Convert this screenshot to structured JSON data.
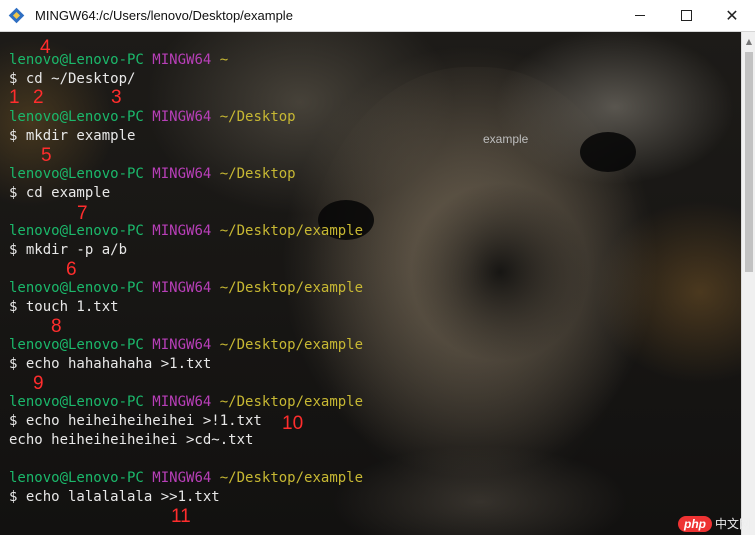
{
  "window": {
    "title": "MINGW64:/c/Users/lenovo/Desktop/example",
    "controls": {
      "minimize_icon": "minimize-icon",
      "maximize_icon": "maximize-icon",
      "close": "✕"
    }
  },
  "desktop_label": "example",
  "prompts": [
    {
      "user": "lenovo@Lenovo-PC",
      "host": "MINGW64",
      "path": "~"
    },
    {
      "user": "lenovo@Lenovo-PC",
      "host": "MINGW64",
      "path": "~/Desktop"
    },
    {
      "user": "lenovo@Lenovo-PC",
      "host": "MINGW64",
      "path": "~/Desktop"
    },
    {
      "user": "lenovo@Lenovo-PC",
      "host": "MINGW64",
      "path": "~/Desktop/example"
    },
    {
      "user": "lenovo@Lenovo-PC",
      "host": "MINGW64",
      "path": "~/Desktop/example"
    },
    {
      "user": "lenovo@Lenovo-PC",
      "host": "MINGW64",
      "path": "~/Desktop/example"
    },
    {
      "user": "lenovo@Lenovo-PC",
      "host": "MINGW64",
      "path": "~/Desktop/example"
    },
    {
      "user": "lenovo@Lenovo-PC",
      "host": "MINGW64",
      "path": "~/Desktop/example"
    }
  ],
  "commands": [
    "$ cd ~/Desktop/",
    "$ mkdir example",
    "$ cd example",
    "$ mkdir -p a/b",
    "$ touch 1.txt",
    "$ echo hahahahaha >1.txt",
    "$ echo heiheiheiheihei >!1.txt",
    "$ echo lalalalala >>1.txt"
  ],
  "output_lines": [
    "echo heiheiheiheihei >cd~.txt"
  ],
  "markers": [
    "1",
    "2",
    "3",
    "4",
    "5",
    "6",
    "7",
    "8",
    "9",
    "10",
    "11"
  ],
  "watermark": {
    "badge": "php",
    "text": "中文网"
  },
  "colors": {
    "user": "#1bb86b",
    "host": "#b83fb8",
    "path": "#c7b833",
    "marker": "#ff2d2d"
  }
}
